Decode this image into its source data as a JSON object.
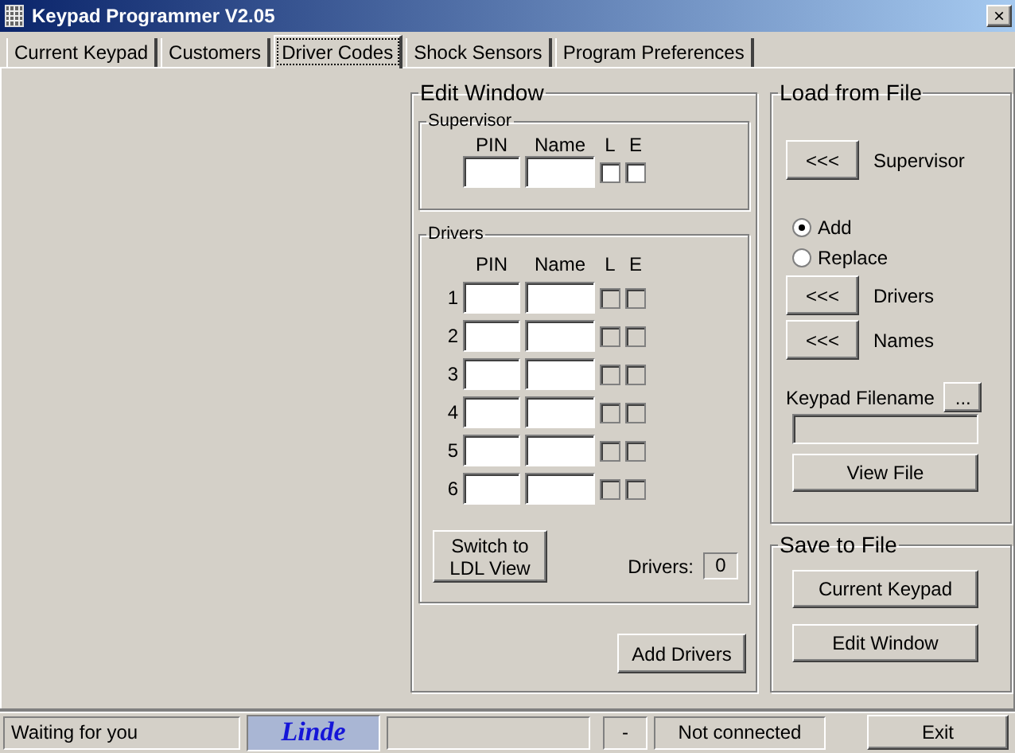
{
  "window": {
    "title": "Keypad Programmer V2.05",
    "close": "×"
  },
  "tabs": [
    {
      "label": "Current Keypad",
      "selected": false
    },
    {
      "label": "Customers",
      "selected": false
    },
    {
      "label": "Driver Codes",
      "selected": true
    },
    {
      "label": "Shock Sensors",
      "selected": false
    },
    {
      "label": "Program Preferences",
      "selected": false
    }
  ],
  "edit_window": {
    "title": "Edit Window",
    "supervisor": {
      "title": "Supervisor",
      "columns": [
        "PIN",
        "Name",
        "L",
        "E"
      ],
      "l_checked": false,
      "e_checked": false
    },
    "drivers": {
      "title": "Drivers",
      "columns": [
        "PIN",
        "Name",
        "L",
        "E"
      ],
      "rows": [
        {
          "number": "1",
          "l_checked": false,
          "e_checked": false,
          "disabled": true
        },
        {
          "number": "2",
          "l_checked": false,
          "e_checked": false,
          "disabled": true
        },
        {
          "number": "3",
          "l_checked": false,
          "e_checked": false,
          "disabled": true
        },
        {
          "number": "4",
          "l_checked": false,
          "e_checked": false,
          "disabled": true
        },
        {
          "number": "5",
          "l_checked": false,
          "e_checked": false,
          "disabled": true
        },
        {
          "number": "6",
          "l_checked": false,
          "e_checked": false,
          "disabled": true
        }
      ],
      "switch_button": "Switch to LDL View",
      "count_label": "Drivers:",
      "count": "0"
    },
    "add_button": "Add Drivers"
  },
  "load_from_file": {
    "title": "Load from File",
    "supervisor_button": "<<<",
    "supervisor_label": "Supervisor",
    "modes": [
      {
        "label": "Add",
        "selected": true
      },
      {
        "label": "Replace",
        "selected": false
      }
    ],
    "drivers_button": "<<<",
    "drivers_label": "Drivers",
    "names_button": "<<<",
    "names_label": "Names",
    "filename_label": "Keypad Filename",
    "browse_button": "...",
    "view_button": "View File"
  },
  "save_to_file": {
    "title": "Save to File",
    "buttons": [
      "Current Keypad",
      "Edit Window"
    ]
  },
  "status_bar": {
    "message": "Waiting for you",
    "logo": "Linde",
    "indicator": "-",
    "connection": "Not connected",
    "exit_button": "Exit"
  }
}
